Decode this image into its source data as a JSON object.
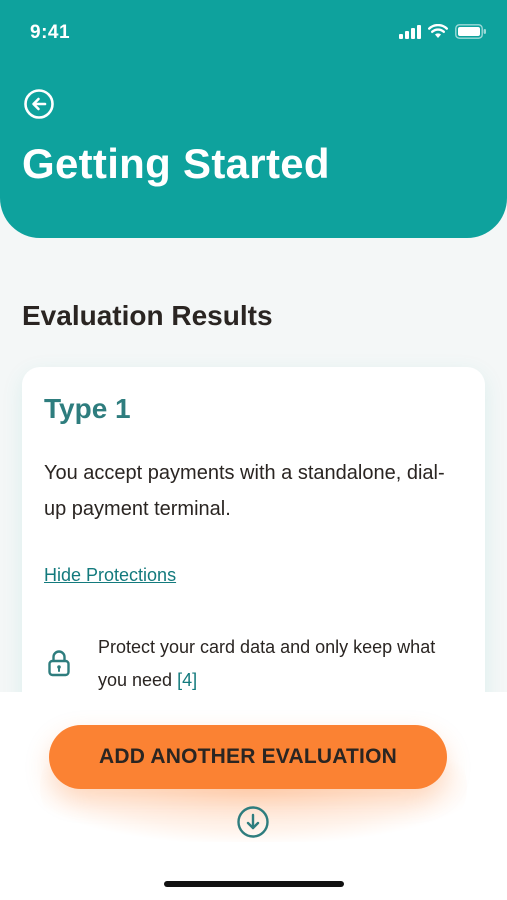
{
  "status_bar": {
    "time": "9:41",
    "icons": [
      "signal-icon",
      "wifi-icon",
      "battery-icon"
    ]
  },
  "header": {
    "back_icon": "arrow-left-circle-icon",
    "title": "Getting Started"
  },
  "section": {
    "title": "Evaluation Results"
  },
  "card": {
    "title": "Type 1",
    "description": "You accept payments with a standalone, dial-up payment terminal.",
    "toggle_link": "Hide Protections",
    "protections": [
      {
        "icon": "lock-icon",
        "text": "Protect your card data and only keep what you need",
        "ref": "[4]"
      }
    ]
  },
  "bottom": {
    "button_label": "ADD ANOTHER EVALUATION",
    "scroll_icon": "arrow-down-circle-icon"
  },
  "colors": {
    "header_teal": "#0ea29d",
    "card_title_teal": "#2e7d7e",
    "link_teal": "#137a7d",
    "accent_orange": "#fb8233",
    "background": "#f4f7f7"
  }
}
